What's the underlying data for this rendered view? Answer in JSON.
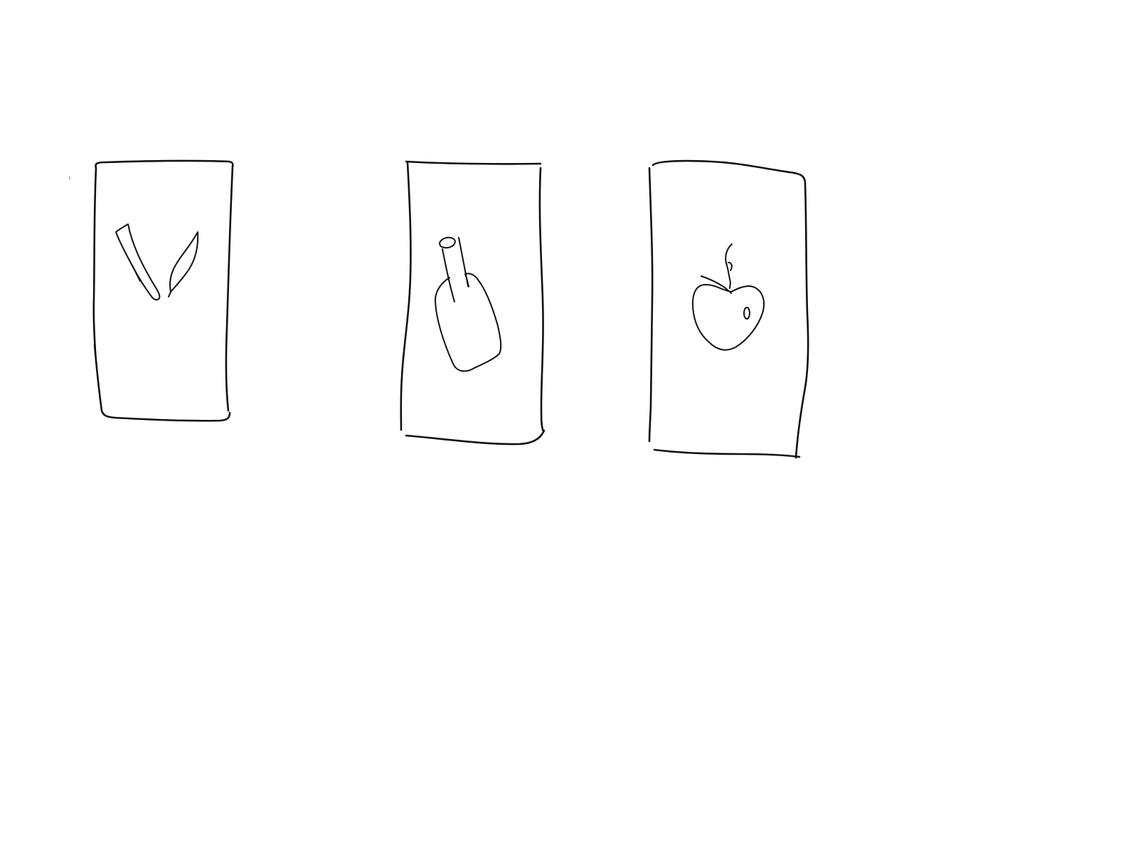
{
  "canvas": {
    "background": "#ffffff",
    "ink_color": "#111111"
  },
  "cards": [
    {
      "icon": "leaf-sprout-icon"
    },
    {
      "icon": "bottle-with-straw-icon"
    },
    {
      "icon": "apple-icon"
    }
  ]
}
